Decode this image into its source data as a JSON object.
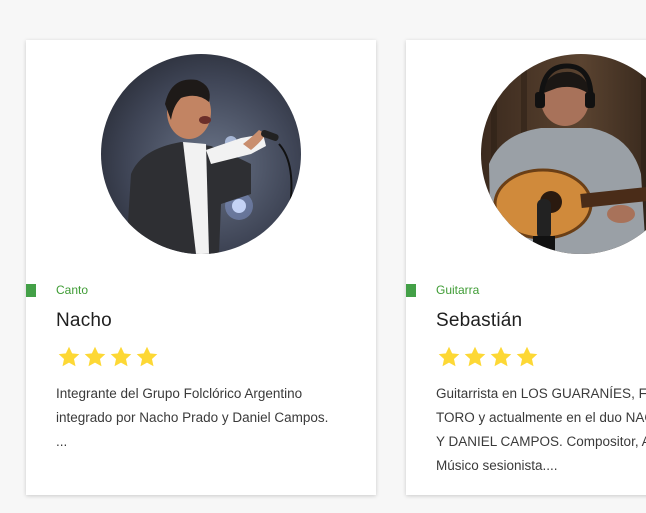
{
  "cards": [
    {
      "category": "Canto",
      "name": "Nacho",
      "rating": 4,
      "rating_max": 4,
      "description_lines": [
        "Integrante del Grupo Folclórico Argentino",
        "integrado por Nacho Prado y Daniel Campos.",
        "..."
      ]
    },
    {
      "category": "Guitarra",
      "name": "Sebastián",
      "rating": 4,
      "rating_max": 4,
      "description_lines": [
        "Guitarrista en LOS GUARANÍES, FA",
        "TORO y actualmente en el duo NAC",
        "Y DANIEL CAMPOS. Compositor, A",
        "Músico sesionista...."
      ]
    }
  ],
  "colors": {
    "accent_green": "#43a047",
    "category_text": "#3f9c35",
    "star": "#fdd835"
  }
}
